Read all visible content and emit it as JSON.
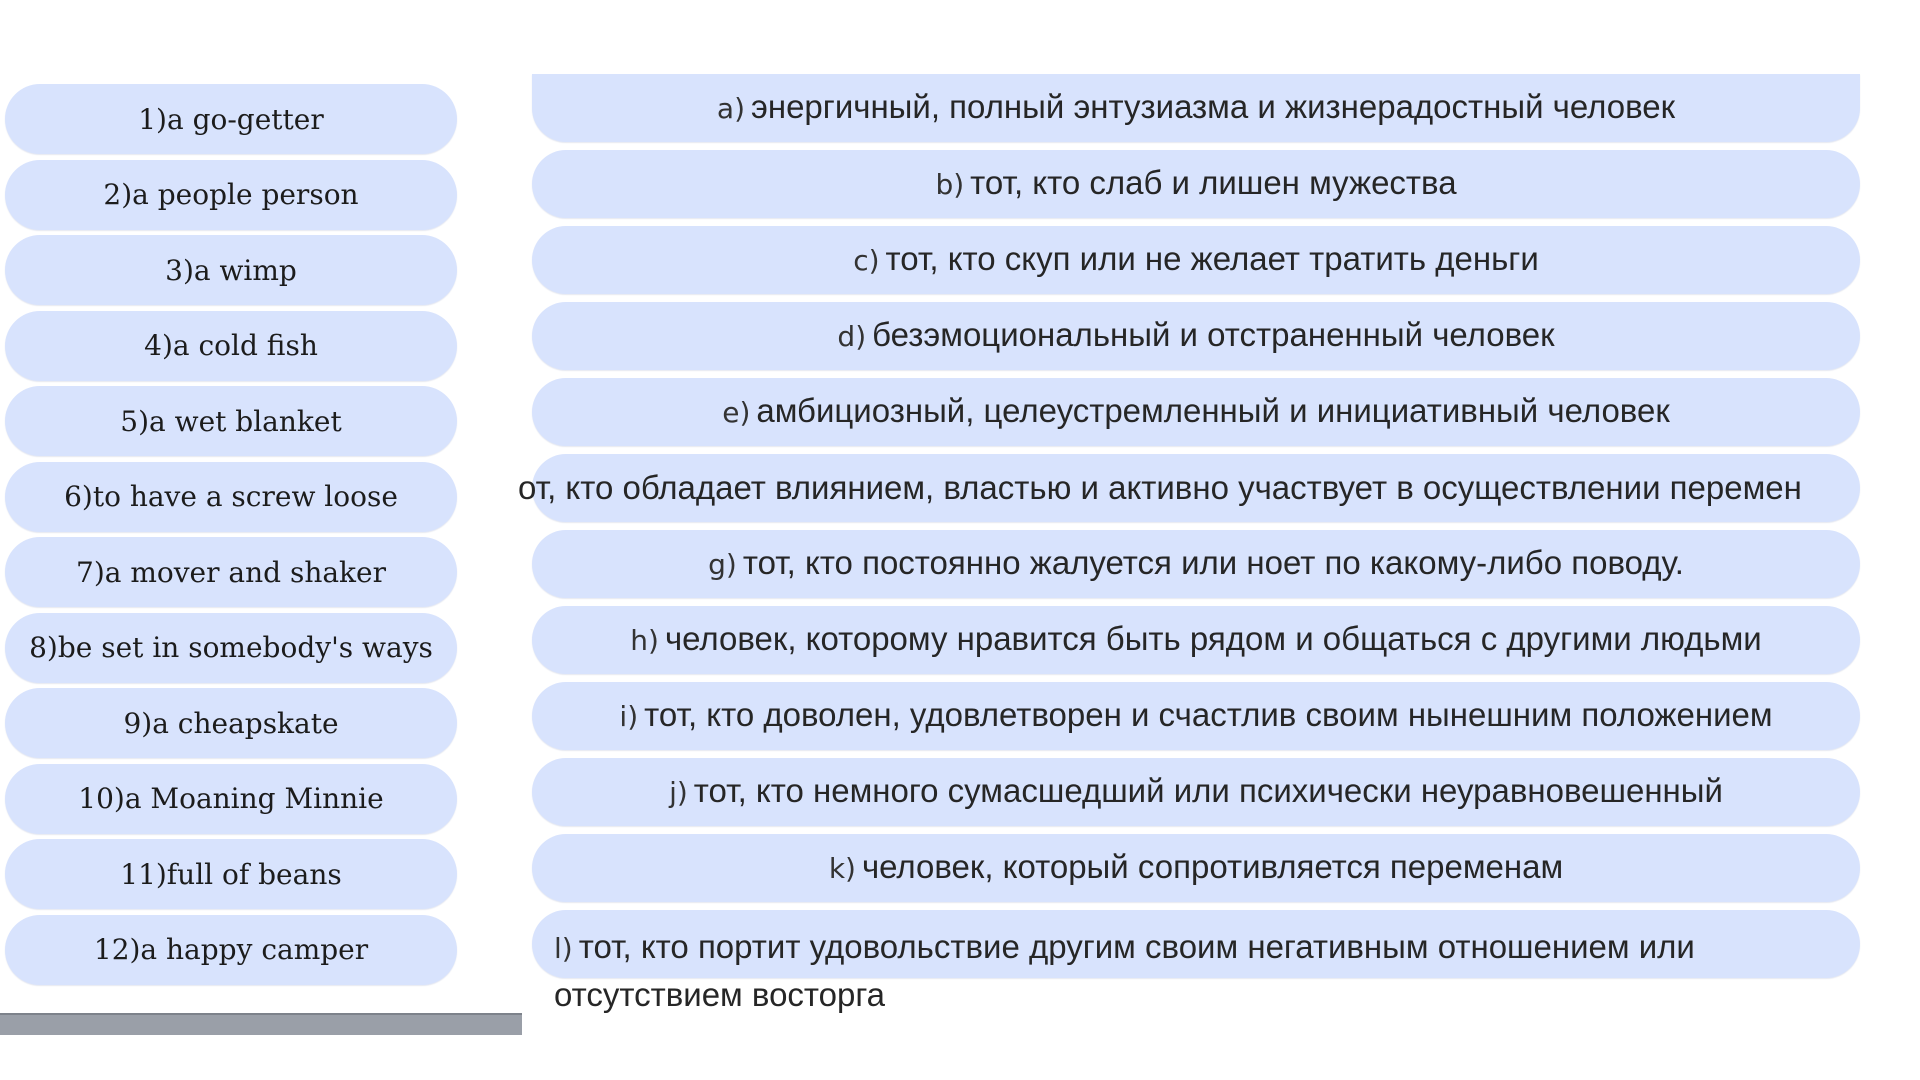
{
  "terms": [
    "1)a go-getter",
    "2)a people person",
    "3)a wimp",
    "4)a cold fish",
    "5)a wet blanket",
    "6)to have a screw loose",
    "7)a mover and shaker",
    "8)be set in somebody's ways",
    "9)a cheapskate",
    "10)a Moaning Minnie",
    "11)full of beans",
    "12)a happy camper"
  ],
  "definitions": [
    {
      "letter": "a)",
      "text": "энергичный, полный энтузиазма и жизнерадостный человек"
    },
    {
      "letter": "b)",
      "text": "тот, кто слаб и лишен мужества"
    },
    {
      "letter": "c)",
      "text": "тот, кто скуп или не желает тратить деньги"
    },
    {
      "letter": "d)",
      "text": "безэмоциональный и отстраненный человек"
    },
    {
      "letter": "e)",
      "text": "амбициозный, целеустремленный и инициативный человек"
    },
    {
      "letter": "",
      "text": "от, кто обладает влиянием, властью и активно участвует в осуществлении перемен"
    },
    {
      "letter": "g)",
      "text": "тот, кто постоянно жалуется или ноет по какому-либо поводу."
    },
    {
      "letter": "h)",
      "text": "человек, которому нравится быть рядом и общаться с другими людьми"
    },
    {
      "letter": "i)",
      "text": "тот, кто доволен, удовлетворен и счастлив своим нынешним положением"
    },
    {
      "letter": "j)",
      "text": "тот, кто немного сумасшедший или психически неуравновешенный"
    },
    {
      "letter": "k)",
      "text": "человек, который сопротивляется переменам"
    },
    {
      "letter": "l)",
      "text": "тот, кто портит удовольствие другим своим негативным отношением или отсутствием восторга"
    }
  ]
}
